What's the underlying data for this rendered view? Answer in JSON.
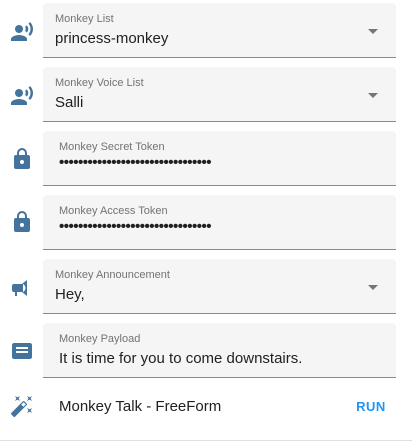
{
  "rows": {
    "monkey_list": {
      "icon": "account-voice-icon",
      "label": "Monkey List",
      "value": "princess-monkey"
    },
    "voice_list": {
      "icon": "account-voice-icon",
      "label": "Monkey Voice List",
      "value": "Salli"
    },
    "secret_token": {
      "icon": "lock-icon",
      "label": "Monkey Secret Token",
      "value": "••••••••••••••••••••••••••••••••"
    },
    "access_token": {
      "icon": "lock-icon",
      "label": "Monkey Access Token",
      "value": "••••••••••••••••••••••••••••••••"
    },
    "announcement": {
      "icon": "bullhorn-icon",
      "label": "Monkey Announcement",
      "value": "Hey,"
    },
    "payload": {
      "icon": "message-text-icon",
      "label": "Monkey Payload",
      "value": "It is time for you to come downstairs."
    }
  },
  "script": {
    "icon": "script-wand-icon",
    "name": "Monkey Talk - FreeForm",
    "action": "RUN"
  },
  "colors": {
    "icon": "#44739e",
    "accent": "#2196f3",
    "field_bg": "#f5f5f5"
  }
}
